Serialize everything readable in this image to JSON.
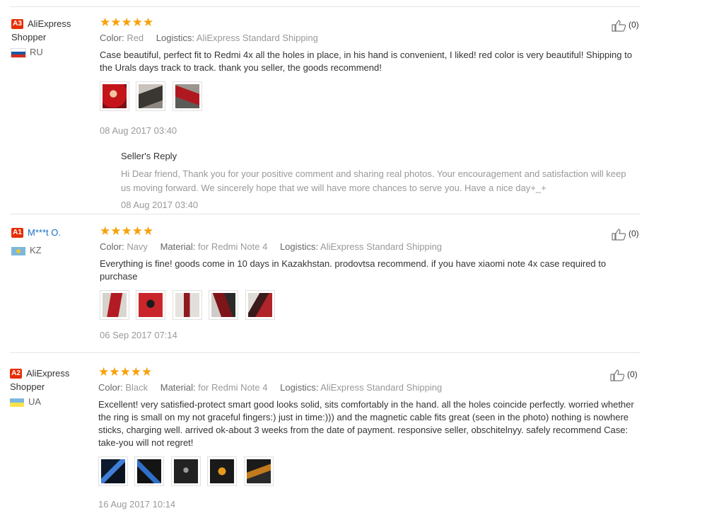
{
  "reviews": [
    {
      "badge": "A3",
      "user": "AliExpress Shopper",
      "user_is_link": false,
      "country": "RU",
      "stars": 5,
      "attributes": [
        {
          "key": "Color:",
          "value": "Red"
        },
        {
          "key": "Logistics:",
          "value": "AliExpress Standard Shipping"
        }
      ],
      "text": "Case beautiful, perfect fit to Redmi 4x all the holes in place, in his hand is convenient, I liked! red color is very beautiful! Shipping to the Urals days track to track. thank you seller, the goods recommend!",
      "photo_count": 3,
      "date": "08 Aug 2017 03:40",
      "helpful": "(0)",
      "reply": {
        "title": "Seller's Reply",
        "text": "Hi Dear friend, Thank you for your positive comment and sharing real photos. Your encouragement and satisfaction will keep us moving forward. We sincerely hope that we will have more chances to serve you. Have a nice day+_+",
        "date": "08 Aug 2017 03:40"
      }
    },
    {
      "badge": "A1",
      "user": "M***t O.",
      "user_is_link": true,
      "country": "KZ",
      "stars": 5,
      "attributes": [
        {
          "key": "Color:",
          "value": "Navy"
        },
        {
          "key": "Material:",
          "value": "for Redmi Note 4"
        },
        {
          "key": "Logistics:",
          "value": "AliExpress Standard Shipping"
        }
      ],
      "text": "Everything is fine! goods come in 10 days in Kazakhstan. prodovtsa recommend. if you have xiaomi note 4x case required to purchase",
      "photo_count": 5,
      "date": "06 Sep 2017 07:14",
      "helpful": "(0)"
    },
    {
      "badge": "A2",
      "user": "AliExpress Shopper",
      "user_is_link": false,
      "country": "UA",
      "stars": 5,
      "attributes": [
        {
          "key": "Color:",
          "value": "Black"
        },
        {
          "key": "Material:",
          "value": "for Redmi Note 4"
        },
        {
          "key": "Logistics:",
          "value": "AliExpress Standard Shipping"
        }
      ],
      "text": "Excellent! very satisfied-protect smart good looks solid, sits comfortably in the hand. all the holes coincide perfectly. worried whether the ring is small on my not graceful fingers:) just in time:))) and the magnetic cable fits great (seen in the photo) nothing is nowhere sticks, charging well. arrived ok-about 3 weeks from the date of payment. responsive seller, obschitelnyy. safely recommend Case: take-you will not regret!",
      "photo_count": 5,
      "date": "16 Aug 2017 10:14",
      "helpful": "(0)"
    }
  ],
  "colors": {
    "accent": "#e62e04",
    "star": "#f7a10a",
    "link": "#1b6ec2"
  },
  "icons": {
    "helpful": "thumbs-up-icon",
    "star": "star-icon"
  }
}
